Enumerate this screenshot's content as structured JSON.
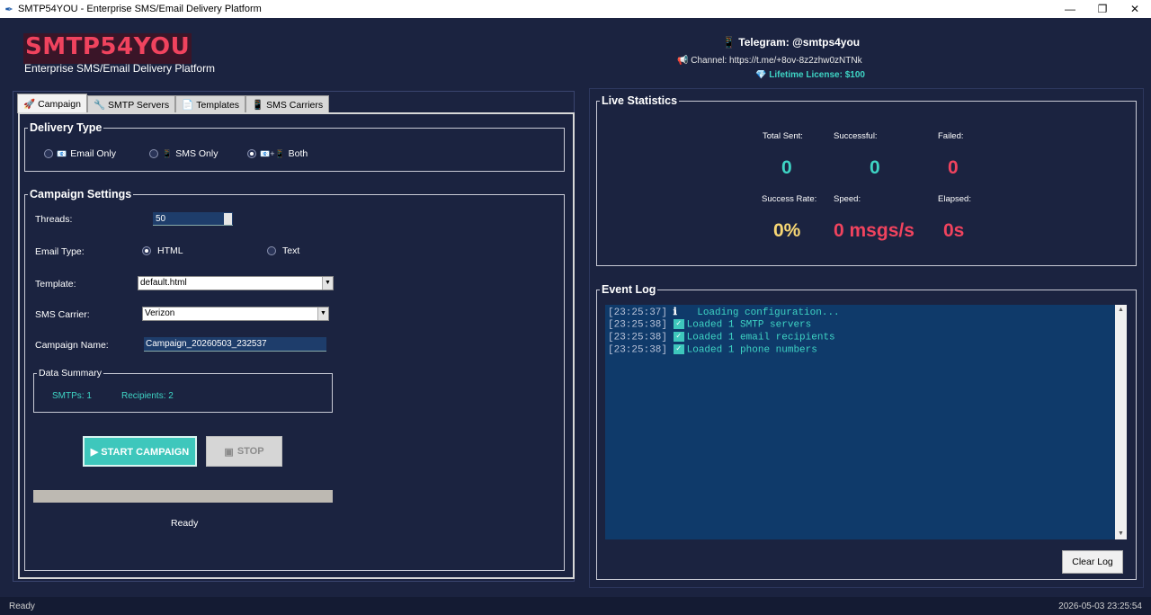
{
  "window": {
    "title": "SMTP54YOU - Enterprise SMS/Email Delivery Platform",
    "minimize": "—",
    "restore": "❐",
    "close": "✕"
  },
  "header": {
    "brand": "SMTP54YOU",
    "tagline": "Enterprise SMS/Email Delivery Platform",
    "telegram": "📱 Telegram: @smtps4you",
    "channel": "📢 Channel: https://t.me/+8ov-8z2zhw0zNTNk",
    "license": "💎 Lifetime License: $100"
  },
  "tabs": [
    {
      "icon": "🚀",
      "label": "Campaign"
    },
    {
      "icon": "🔧",
      "label": "SMTP Servers"
    },
    {
      "icon": "📄",
      "label": "Templates"
    },
    {
      "icon": "📱",
      "label": "SMS Carriers"
    }
  ],
  "delivery": {
    "legend": "Delivery Type",
    "options": [
      {
        "icon": "📧",
        "label": "Email Only",
        "selected": false
      },
      {
        "icon": "📱",
        "label": "SMS Only",
        "selected": false
      },
      {
        "icon": "📧+📱",
        "label": "Both",
        "selected": true
      }
    ]
  },
  "settings": {
    "legend": "Campaign Settings",
    "threads_label": "Threads:",
    "threads_value": "50",
    "email_type_label": "Email Type:",
    "email_type_options": [
      {
        "label": "HTML",
        "selected": true
      },
      {
        "label": "Text",
        "selected": false
      }
    ],
    "template_label": "Template:",
    "template_value": "default.html",
    "carrier_label": "SMS Carrier:",
    "carrier_value": "Verizon",
    "campaign_name_label": "Campaign Name:",
    "campaign_name_value": "Campaign_20260503_232537"
  },
  "summary": {
    "legend": "Data Summary",
    "smtps": "SMTPs: 1",
    "recipients": "Recipients: 2"
  },
  "actions": {
    "start": "▶ START CAMPAIGN",
    "stop": "STOP",
    "stop_icon": "▣"
  },
  "progress": {
    "value": 0
  },
  "status_text": "Ready",
  "stats": {
    "legend": "Live Statistics",
    "total_sent_label": "Total Sent:",
    "total_sent": "0",
    "successful_label": "Successful:",
    "successful": "0",
    "failed_label": "Failed:",
    "failed": "0",
    "success_rate_label": "Success Rate:",
    "success_rate": "0%",
    "speed_label": "Speed:",
    "speed": "0 msgs/s",
    "elapsed_label": "Elapsed:",
    "elapsed": "0s"
  },
  "log": {
    "legend": "Event Log",
    "entries": [
      {
        "ts": "[23:25:37]",
        "icon": "ℹ",
        "text": " Loading configuration..."
      },
      {
        "ts": "[23:25:38]",
        "icon": "✓",
        "text": "Loaded 1 SMTP servers"
      },
      {
        "ts": "[23:25:38]",
        "icon": "✓",
        "text": "Loaded 1 email recipients"
      },
      {
        "ts": "[23:25:38]",
        "icon": "✓",
        "text": "Loaded 1 phone numbers"
      }
    ],
    "clear_label": "Clear Log"
  },
  "statusbar": {
    "left": "Ready",
    "right": "2026-05-03 23:25:54"
  },
  "colors": {
    "background": "#1b2340",
    "accent_teal": "#3ed4c4",
    "accent_red": "#f0435e",
    "accent_yellow": "#f7d774",
    "log_background": "#0f3a6a"
  }
}
